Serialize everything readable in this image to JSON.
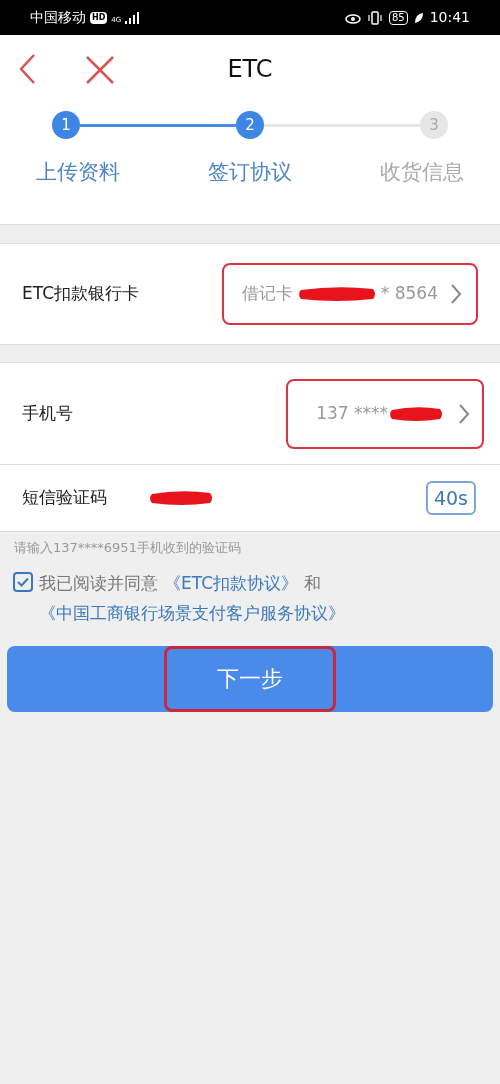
{
  "status_bar": {
    "carrier": "中国移动",
    "hd": "HD",
    "network": "4G",
    "battery": "85",
    "time": "10:41"
  },
  "header": {
    "title": "ETC"
  },
  "steps": [
    {
      "number": "1",
      "label": "上传资料",
      "active": true
    },
    {
      "number": "2",
      "label": "签订协议",
      "active": true
    },
    {
      "number": "3",
      "label": "收货信息",
      "active": false
    }
  ],
  "bank_card": {
    "label": "ETC扣款银行卡",
    "prefix": "借记卡",
    "redacted": true,
    "suffix": "* 8564",
    "highlighted": true
  },
  "phone": {
    "label": "手机号",
    "prefix": "137 ****",
    "redacted": true,
    "highlighted": true
  },
  "sms_code": {
    "label": "短信验证码",
    "redacted": true,
    "countdown": "40s"
  },
  "hint": "请输入137****6951手机收到的验证码",
  "agreement": {
    "checked": true,
    "text": "我已阅读并同意",
    "link_1": "《ETC扣款协议》",
    "joiner": "和",
    "link_2": "《中国工商银行场景支付客户服务协议》"
  },
  "next_button": {
    "label": "下一步",
    "highlighted": true
  }
}
